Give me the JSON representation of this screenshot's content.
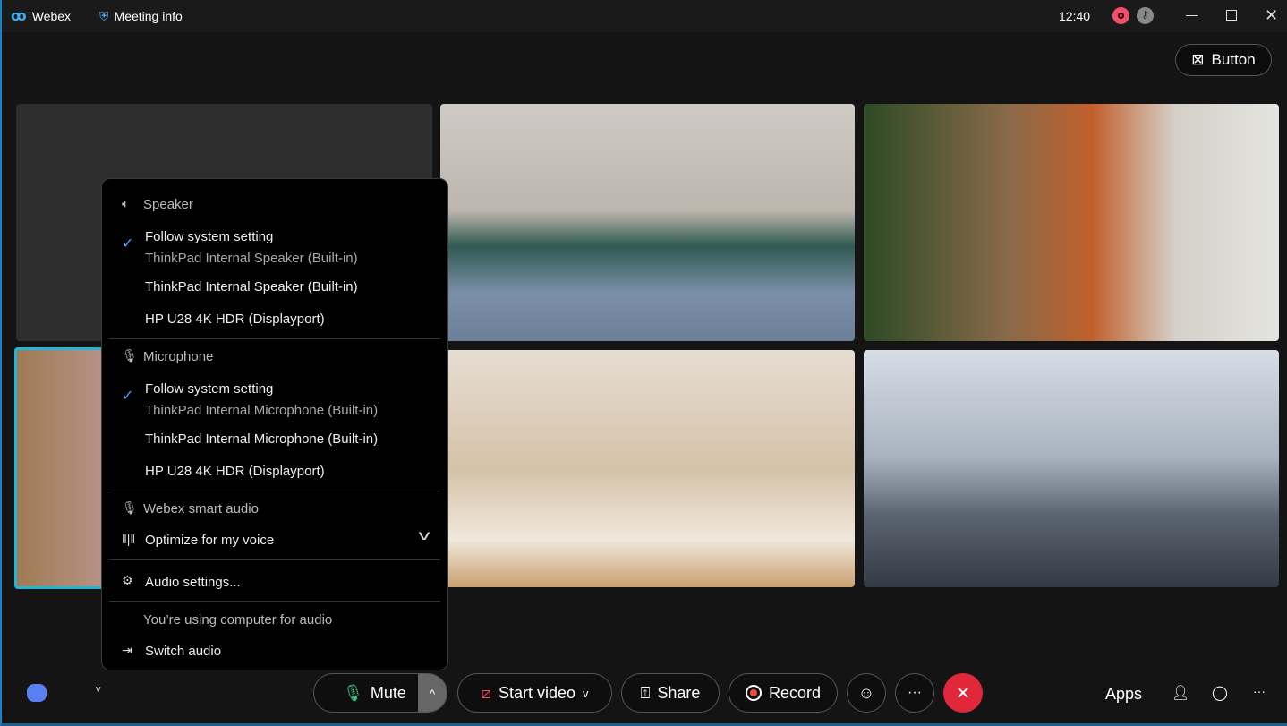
{
  "titlebar": {
    "app_name": "Webex",
    "meeting_info": "Meeting info",
    "time": "12:40"
  },
  "top_button": {
    "label": "Button"
  },
  "menu": {
    "speaker": {
      "header": "Speaker",
      "selected_title": "Follow system setting",
      "selected_sub": "ThinkPad Internal Speaker (Built-in)",
      "options": [
        "ThinkPad Internal Speaker (Built-in)",
        "HP U28 4K HDR (Displayport)"
      ]
    },
    "microphone": {
      "header": "Microphone",
      "selected_title": "Follow system setting",
      "selected_sub": "ThinkPad Internal Microphone (Built-in)",
      "options": [
        "ThinkPad Internal Microphone (Built-in)",
        "HP U28 4K HDR (Displayport)"
      ]
    },
    "smart_audio": {
      "header": "Webex smart audio",
      "value": "Optimize for my voice"
    },
    "audio_settings": "Audio settings...",
    "status": "You’re using computer for audio",
    "switch_audio": "Switch audio"
  },
  "controls": {
    "mute": "Mute",
    "start_video": "Start video",
    "share": "Share",
    "record": "Record",
    "apps": "Apps"
  },
  "colors": {
    "accent": "#1d7fc4",
    "end_call": "#e0283a",
    "record_dot": "#f0503c",
    "self_view_border": "#1fb6d8"
  }
}
